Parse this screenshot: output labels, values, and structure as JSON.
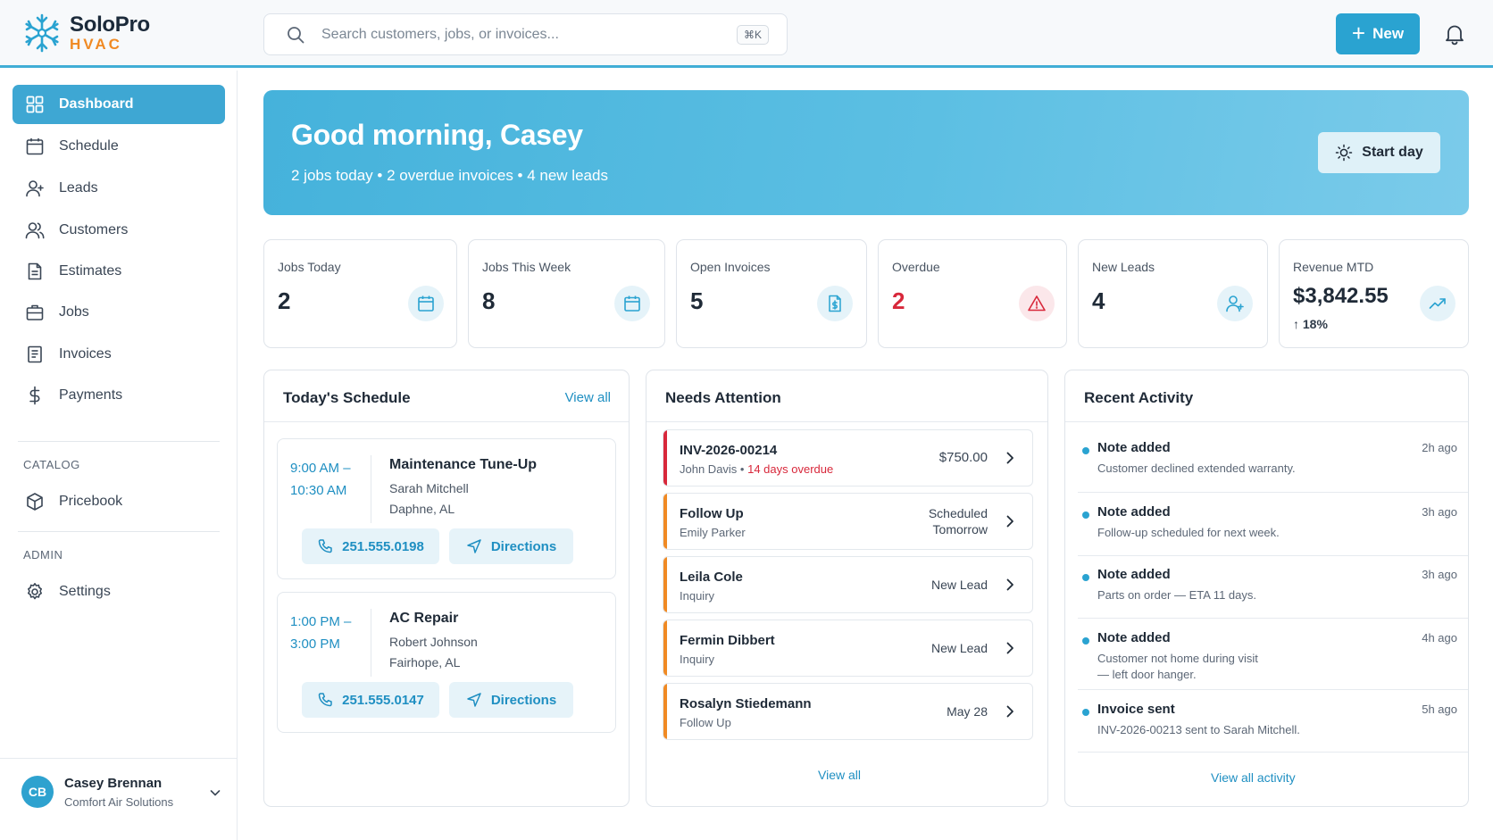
{
  "brand": {
    "name": "SoloPro",
    "sub": "HVAC",
    "accent": "#2aa3d1",
    "sub_color": "#f08a24"
  },
  "search": {
    "placeholder": "Search customers, jobs, or invoices...",
    "shortcut": "⌘K"
  },
  "header": {
    "new_label": "New"
  },
  "sidebar": {
    "items": [
      {
        "label": "Dashboard",
        "icon": "grid-icon",
        "active": true
      },
      {
        "label": "Schedule",
        "icon": "calendar-icon"
      },
      {
        "label": "Leads",
        "icon": "user-plus-icon"
      },
      {
        "label": "Customers",
        "icon": "users-icon"
      },
      {
        "label": "Estimates",
        "icon": "document-icon"
      },
      {
        "label": "Jobs",
        "icon": "briefcase-icon"
      },
      {
        "label": "Invoices",
        "icon": "invoice-icon"
      },
      {
        "label": "Payments",
        "icon": "dollar-icon"
      }
    ],
    "catalog_label": "CATALOG",
    "catalog_items": [
      {
        "label": "Pricebook",
        "icon": "box-icon"
      }
    ],
    "admin_label": "ADMIN",
    "admin_items": [
      {
        "label": "Settings",
        "icon": "gear-icon"
      }
    ]
  },
  "user": {
    "initials": "CB",
    "name": "Casey Brennan",
    "org": "Comfort Air Solutions"
  },
  "hero": {
    "greeting": "Good morning, Casey",
    "summary": "2 jobs today • 2 overdue invoices • 4 new leads",
    "start_label": "Start day"
  },
  "stats": [
    {
      "label": "Jobs Today",
      "value": "2",
      "icon": "calendar-icon"
    },
    {
      "label": "Jobs This Week",
      "value": "8",
      "icon": "calendar-icon"
    },
    {
      "label": "Open Invoices",
      "value": "5",
      "icon": "invoice-dollar-icon"
    },
    {
      "label": "Overdue",
      "value": "2",
      "icon": "alert-triangle-icon",
      "status": "#d8283b"
    },
    {
      "label": "New Leads",
      "value": "4",
      "icon": "user-plus-icon"
    },
    {
      "label": "Revenue MTD",
      "value": "$3,842.55",
      "change": "↑ 18%",
      "icon": "trending-up-icon"
    }
  ],
  "schedule": {
    "title": "Today's Schedule",
    "view_all": "View all",
    "jobs": [
      {
        "time_start": "9:00 AM –",
        "time_end": "10:30 AM",
        "title": "Maintenance Tune-Up",
        "customer": "Sarah Mitchell",
        "city": "Daphne, AL",
        "phone": "251.555.0198",
        "directions": "Directions"
      },
      {
        "time_start": "1:00 PM –",
        "time_end": "3:00 PM",
        "title": "AC Repair",
        "customer": "Robert Johnson",
        "city": "Fairhope, AL",
        "phone": "251.555.0147",
        "directions": "Directions"
      }
    ]
  },
  "attention": {
    "title": "Needs Attention",
    "view_all": "View all",
    "items": [
      {
        "title": "INV-2026-00214",
        "sub": "John Davis • ",
        "sub_alert": "14 days overdue",
        "right": "$750.00",
        "color": "#d8283b"
      },
      {
        "title": "Follow Up",
        "sub": "Emily Parker",
        "right": "Scheduled",
        "right2": "Tomorrow",
        "color": "#f08a24"
      },
      {
        "title": "Leila Cole",
        "sub": "Inquiry",
        "right": "New Lead",
        "color": "#f08a24"
      },
      {
        "title": "Fermin Dibbert",
        "sub": "Inquiry",
        "right": "New Lead",
        "color": "#f08a24"
      },
      {
        "title": "Rosalyn Stiedemann",
        "sub": "Follow Up",
        "right": "May 28",
        "color": "#f08a24"
      }
    ]
  },
  "activity": {
    "title": "Recent Activity",
    "view_all": "View all activity",
    "items": [
      {
        "title": "Note added",
        "desc": "Customer declined extended warranty.",
        "time": "2h ago"
      },
      {
        "title": "Note added",
        "desc": "Follow-up scheduled for next week.",
        "time": "3h ago"
      },
      {
        "title": "Note added",
        "desc": "Parts on order — ETA 11 days.",
        "time": "3h ago"
      },
      {
        "title": "Note added",
        "desc": "Customer not home during visit",
        "desc2": "— left door hanger.",
        "time": "4h ago"
      },
      {
        "title": "Invoice sent",
        "desc": "INV-2026-00213 sent to Sarah Mitchell.",
        "time": "5h ago"
      }
    ]
  }
}
